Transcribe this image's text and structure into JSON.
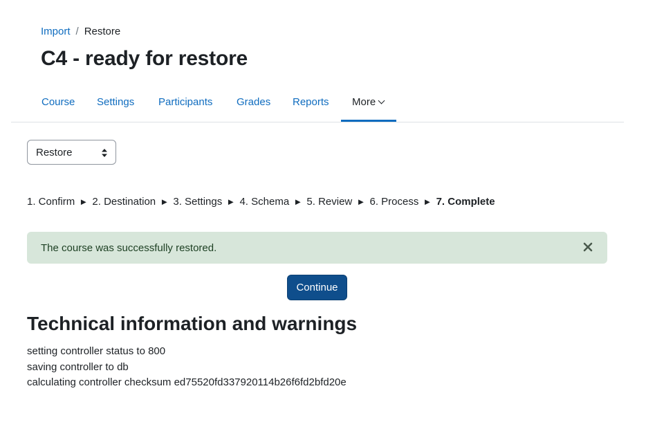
{
  "breadcrumb": {
    "items": [
      {
        "label": "Import",
        "link": true
      },
      {
        "label": "Restore",
        "link": false
      }
    ],
    "separator": "/"
  },
  "page": {
    "title": "C4 - ready for restore"
  },
  "nav": {
    "tabs": [
      {
        "label": "Course",
        "active": false
      },
      {
        "label": "Settings",
        "active": false
      },
      {
        "label": "Participants",
        "active": false
      },
      {
        "label": "Grades",
        "active": false
      },
      {
        "label": "Reports",
        "active": false
      },
      {
        "label": "More",
        "active": true,
        "dropdown": true
      }
    ]
  },
  "select": {
    "value": "Restore"
  },
  "steps": {
    "items": [
      "1. Confirm",
      "2. Destination",
      "3. Settings",
      "4. Schema",
      "5. Review",
      "6. Process",
      "7. Complete"
    ],
    "current_index": 6,
    "separator": "►"
  },
  "alert": {
    "message": "The course was successfully restored.",
    "type": "success",
    "color": "#d7e6da"
  },
  "actions": {
    "continue_label": "Continue",
    "color": "#0f4e8c"
  },
  "technical": {
    "title": "Technical information and warnings",
    "lines": [
      "setting controller status to 800",
      "saving controller to db",
      "calculating controller checksum ed75520fd337920114b26f6fd2bfd20e"
    ]
  },
  "colors": {
    "link": "#0f6cbf",
    "text": "#1d2125",
    "border": "#dee2e6"
  }
}
